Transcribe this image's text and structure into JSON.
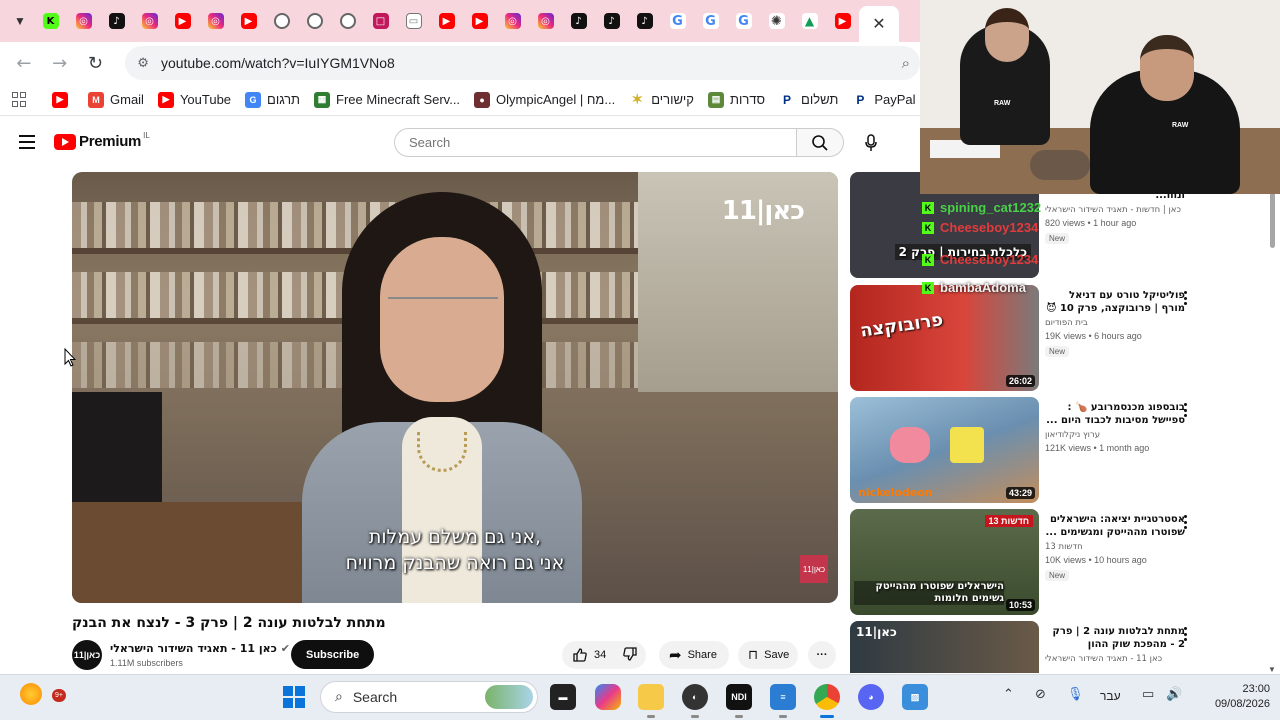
{
  "browser": {
    "tab_icons": [
      "kick-icon",
      "instagram-icon",
      "tiktok-icon",
      "instagram-icon",
      "youtube-icon",
      "instagram-icon",
      "youtube-icon",
      "chrome-icon",
      "chrome-icon",
      "chrome-icon",
      "app-icon",
      "app-icon",
      "youtube-icon",
      "youtube-icon",
      "instagram-icon",
      "instagram-icon",
      "tiktok-icon",
      "tiktok-icon",
      "tiktok-icon",
      "google-icon",
      "google-icon",
      "google-icon",
      "openai-icon",
      "drive-icon",
      "youtube-icon"
    ],
    "close_tab": "✕",
    "url": "youtube.com/watch?v=IuIYGM1VNo8",
    "bookmarks": [
      {
        "label": "",
        "icon": "youtube-icon",
        "color": "#ff0000"
      },
      {
        "label": "Gmail",
        "icon": "gmail-icon",
        "color": "#ea4335"
      },
      {
        "label": "YouTube",
        "icon": "youtube-icon",
        "color": "#ff0000"
      },
      {
        "label": "תרגום",
        "icon": "translate-icon",
        "color": "#4285f4"
      },
      {
        "label": "Free Minecraft Serv...",
        "icon": "minecraft-icon",
        "color": "#2e7d32"
      },
      {
        "label": "OlympicAngel | מח...",
        "icon": "avatar-icon",
        "color": "#6d2f2f"
      },
      {
        "label": "קישורים",
        "icon": "star-icon",
        "color": "#e0c23a"
      },
      {
        "label": "סדרות",
        "icon": "folder-icon",
        "color": "#5d8a3a"
      },
      {
        "label": "תשלום",
        "icon": "paypal-icon",
        "color": "#003087"
      },
      {
        "label": "PayPal",
        "icon": "paypal-icon",
        "color": "#003087"
      }
    ]
  },
  "youtube": {
    "logo_text": "Premium",
    "logo_country": "IL",
    "search_placeholder": "Search",
    "video": {
      "channel_watermark": "כאן|11",
      "subtitle_line1": "אני גם משלם עמלות,",
      "subtitle_line2": "אני גם רואה שהבנק מרוויח",
      "title": "מתחת לבלטות עונה 2 | פרק 3 - לנצח את הבנק",
      "channel_name": "כאן 11 - תאגיד השידור הישראלי",
      "channel_avatar_text": "כאן|11",
      "subscribers": "1.11M subscribers",
      "subscribe_label": "Subscribe",
      "likes": "34",
      "share_label": "Share",
      "save_label": "Save"
    },
    "related": [
      {
        "title": "הפוליטיקאים מכסיחים - ונוח...",
        "channel": "כאן | חדשות - תאגיד השידור הישראלי",
        "views": "820 views • 1 hour ago",
        "badge": "New",
        "duration": "",
        "thumb_text": "כלכלת בחירות | פרק 2",
        "thumb_bg": "#3b3b44"
      },
      {
        "title": "פוליטיקל טורט עם דניאל מורף | פרובוקצה, פרק 10 😈",
        "channel": "בית הפודיום",
        "views": "19K views • 6 hours ago",
        "badge": "New",
        "duration": "26:02",
        "thumb_text": "פרובוקצה",
        "thumb_bg": "#b3261e"
      },
      {
        "title": "בובספוג מכנסמרובע 🍗 : ספיישל מסיבות לכבוד היום ...",
        "channel": "ערוץ ניקלודיאון",
        "views": "121K views • 1 month ago",
        "badge": "",
        "duration": "43:29",
        "thumb_text": "nickelodeon",
        "thumb_bg": "#6a8fb0"
      },
      {
        "title": "אסטרטגיית יציאה: הישראלים שפוטרו מההייטק ומגשימים ...",
        "channel": "חדשות 13",
        "views": "10K views • 10 hours ago",
        "badge": "New",
        "duration": "10:53",
        "thumb_text": "הישראלים שפוטרו מההייטק גשימים חלומות",
        "thumb_bg": "#4a5a3a"
      },
      {
        "title": "מתחת לבלטות עונה 2 | פרק 2 - מהפכת שוק ההון",
        "channel": "כאן 11 - תאגיד השידור הישראלי",
        "views": "",
        "badge": "",
        "duration": "",
        "thumb_text": "כאן|11",
        "thumb_bg": "#2f3a42"
      }
    ]
  },
  "chat": [
    {
      "user": "spining_cat1232",
      "color": "#47d147"
    },
    {
      "user": "Cheeseboy1234",
      "color": "#e23b3b"
    },
    {
      "user": "Cheeseboy1234",
      "color": "#e23b3b"
    },
    {
      "user": "bambaAdoma",
      "color": "#e6e6e6"
    }
  ],
  "taskbar": {
    "weather_badge": "9+",
    "search_label": "Search",
    "lang": "עבר",
    "time": "23:00",
    "date": "09/08/2026"
  }
}
